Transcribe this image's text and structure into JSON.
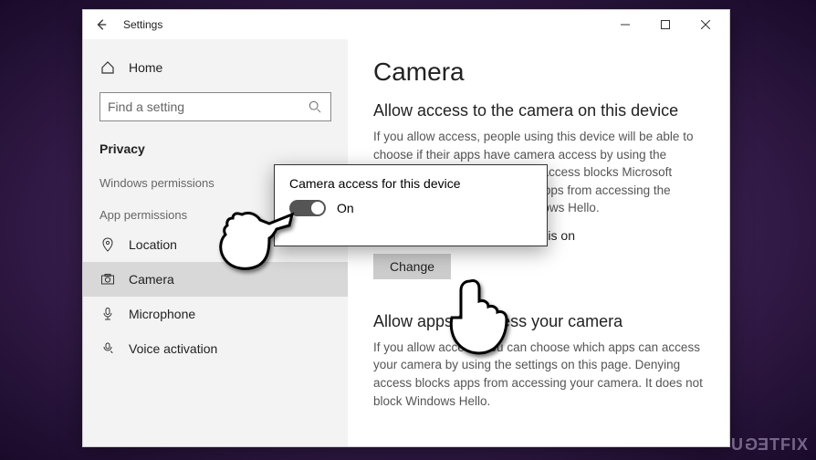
{
  "window": {
    "title": "Settings"
  },
  "sidebar": {
    "home": "Home",
    "search_placeholder": "Find a setting",
    "section": "Privacy",
    "group1": "Windows permissions",
    "group2": "App permissions",
    "items": [
      {
        "label": "Location"
      },
      {
        "label": "Camera"
      },
      {
        "label": "Microphone"
      },
      {
        "label": "Voice activation"
      }
    ]
  },
  "main": {
    "heading": "Camera",
    "section1_title": "Allow access to the camera on this device",
    "section1_desc": "If you allow access, people using this device will be able to choose if their apps have camera access by using the settings on this page. Denying access blocks Microsoft Store apps and most desktop apps from accessing the camera. It does not block Windows Hello.",
    "status_line": "Camera access for this device is on",
    "change_btn": "Change",
    "section2_title": "Allow apps to access your camera",
    "section2_desc": "If you allow access, you can choose which apps can access your camera by using the settings on this page. Denying access blocks apps from accessing your camera. It does not block Windows Hello."
  },
  "popup": {
    "title": "Camera access for this device",
    "state": "On"
  },
  "watermark": "UGETFIX"
}
